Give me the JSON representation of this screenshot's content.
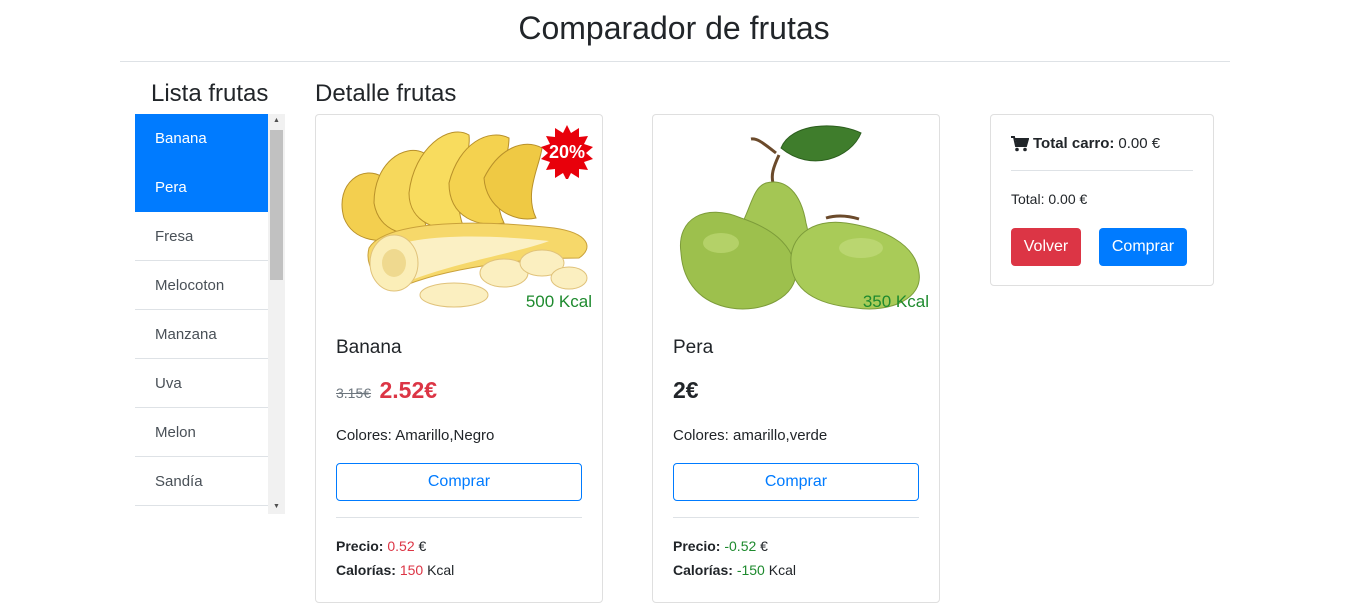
{
  "header": {
    "title": "Comparador de frutas"
  },
  "sidebar": {
    "heading": "Lista frutas",
    "items": [
      {
        "label": "Banana",
        "selected": true
      },
      {
        "label": "Pera",
        "selected": true
      },
      {
        "label": "Fresa",
        "selected": false
      },
      {
        "label": "Melocoton",
        "selected": false
      },
      {
        "label": "Manzana",
        "selected": false
      },
      {
        "label": "Uva",
        "selected": false
      },
      {
        "label": "Melon",
        "selected": false
      },
      {
        "label": "Sandía",
        "selected": false
      }
    ]
  },
  "detail": {
    "heading": "Detalle frutas",
    "cards": [
      {
        "name": "Banana",
        "image": "banana-image",
        "kcal_badge": "500 Kcal",
        "discount_badge": "20%",
        "old_price": "3.15€",
        "price": "2.52€",
        "colors": "Colores: Amarillo,Negro",
        "button": "Comprar",
        "precio_label": "Precio:",
        "precio_value": "0.52",
        "precio_unit": "€",
        "calorias_label": "Calorías:",
        "calorias_value": "150",
        "calorias_unit": "Kcal"
      },
      {
        "name": "Pera",
        "image": "pear-image",
        "kcal_badge": "350 Kcal",
        "price": "2€",
        "colors": "Colores: amarillo,verde",
        "button": "Comprar",
        "precio_label": "Precio:",
        "precio_value": "-0.52",
        "precio_unit": "€",
        "calorias_label": "Calorías:",
        "calorias_value": "-150",
        "calorias_unit": "Kcal"
      }
    ]
  },
  "cart": {
    "icon": "shopping-cart-icon",
    "label": "Total carro:",
    "amount": "0.00 €",
    "total": "Total: 0.00 €",
    "volver_button": "Volver",
    "comprar_button": "Comprar"
  },
  "colors": {
    "primary": "#007bff",
    "danger": "#dc3545",
    "success": "#1e8a2e",
    "border": "#dee2e6"
  }
}
